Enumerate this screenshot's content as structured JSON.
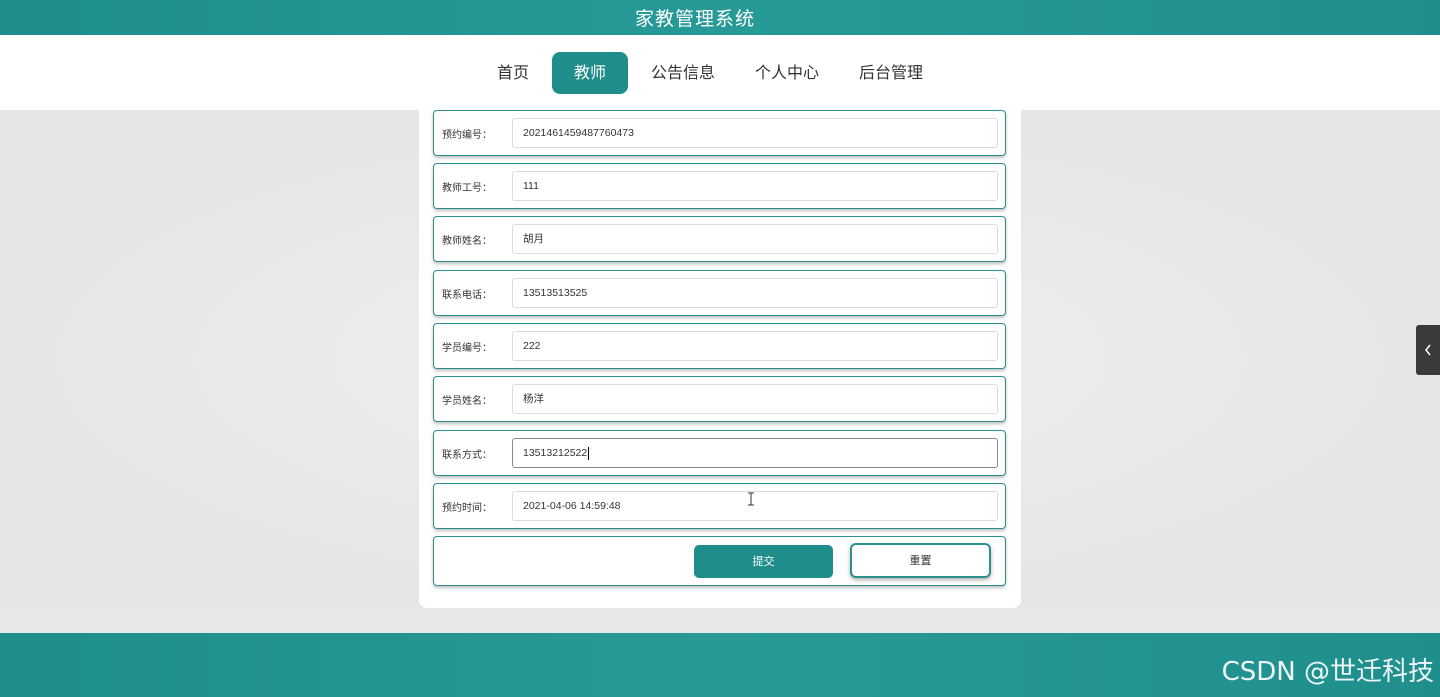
{
  "header": {
    "title": "家教管理系统"
  },
  "nav": {
    "items": [
      {
        "label": "首页"
      },
      {
        "label": "教师"
      },
      {
        "label": "公告信息"
      },
      {
        "label": "个人中心"
      },
      {
        "label": "后台管理"
      }
    ]
  },
  "form": {
    "fields": [
      {
        "label": "预约编号：",
        "value": "2021461459487760473"
      },
      {
        "label": "教师工号：",
        "value": "111"
      },
      {
        "label": "教师姓名：",
        "value": "胡月"
      },
      {
        "label": "联系电话：",
        "value": "13513513525"
      },
      {
        "label": "学员编号：",
        "value": "222"
      },
      {
        "label": "学员姓名：",
        "value": "杨洋"
      },
      {
        "label": "联系方式：",
        "value": "13513212522"
      },
      {
        "label": "预约时间：",
        "value": "2021-04-06 14:59:48"
      }
    ],
    "submit_label": "提交",
    "reset_label": "重置"
  },
  "footer": {
    "watermark": "CSDN @世迁科技"
  },
  "colors": {
    "accent": "#1f8e8b",
    "sidebar_toggle": "#3a3a3a"
  },
  "icons": {
    "side_toggle": "chevron-left-icon",
    "cursor": "text-cursor-icon"
  }
}
